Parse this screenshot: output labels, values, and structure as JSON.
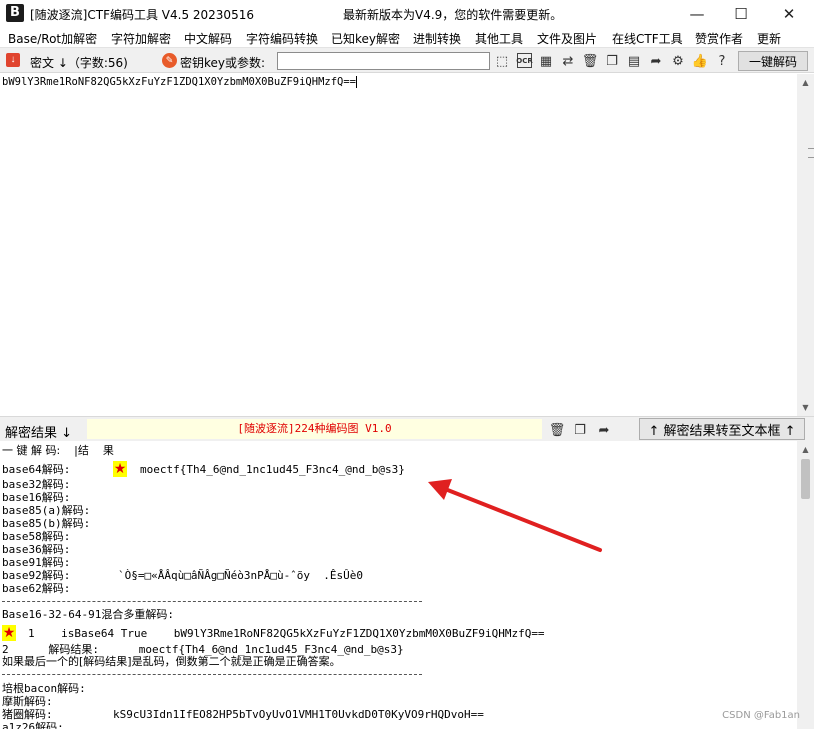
{
  "window": {
    "title": "[随波逐流]CTF编码工具 V4.5 20230516",
    "update_notice": "最新新版本为V4.9，您的软件需要更新。",
    "minimize": "—",
    "maximize": "☐",
    "close": "✕",
    "app_icon": "B"
  },
  "menu": {
    "items": [
      "Base/Rot加解密",
      "字符加解密",
      "中文解码",
      "字符编码转换",
      "已知key解密",
      "进制转换",
      "其他工具",
      "文件及图片",
      "在线CTF工具",
      "赞赏作者",
      "更新"
    ]
  },
  "toolbar": {
    "cipher_label": "密文 ↓（字数:56)",
    "key_label": "密钥key或参数:",
    "key_value": "",
    "ocr_label": "OCR",
    "decode_all_button": "一键解码"
  },
  "input": {
    "ciphertext": "bW9lY3Rme1RoNF82QG5kXzFuYzF1ZDQ1X0YzbmM0X0BuZF9iQHMzfQ=="
  },
  "result_bar": {
    "label": "解密结果 ↓",
    "banner": "[随波逐流]224种编码图 V1.0",
    "transfer_button": "↑ 解密结果转至文本框 ↑"
  },
  "output": {
    "header": "一 键 解 码:    |结    果",
    "lines": [
      {
        "label": "base64解码:",
        "value": "moectf{Th4_6@nd_1nc1ud45_F3nc4_@nd_b@s3}",
        "starred": true
      },
      {
        "label": "base32解码:",
        "value": ""
      },
      {
        "label": "base16解码:",
        "value": ""
      },
      {
        "label": "base85(a)解码:",
        "value": ""
      },
      {
        "label": "base85(b)解码:",
        "value": ""
      },
      {
        "label": "base58解码:",
        "value": ""
      },
      {
        "label": "base36解码:",
        "value": ""
      },
      {
        "label": "base91解码:",
        "value": ""
      },
      {
        "label": "base92解码:",
        "value": "`Ò§=□«ÅÂqù□âÑÂg□Ñéò3nPÅ□ù-ˆõy  .ÊsÛè0"
      },
      {
        "label": "base62解码:",
        "value": ""
      }
    ],
    "separator": "-----------------------------------------------------------",
    "multi_title": "Base16-32-64-91混合多重解码:",
    "multi_row1": "1    isBase64 True    bW9lY3Rme1RoNF82QG5kXzFuYzF1ZDQ1X0YzbmM0X0BuZF9iQHMzfQ==",
    "multi_row2": "2      解码结果:      moectf{Th4_6@nd_1nc1ud45_F3nc4_@nd_b@s3}",
    "multi_note": "如果最后一个的[解码结果]是乱码，倒数第二个就是正确是正确答案。",
    "bacon_title": "培根bacon解码:",
    "morse_title": "摩斯解码:",
    "pigpen_label": "猪圈解码:",
    "pigpen_value": "kS9cU3Idn1IfEO82HP5bTvOyUvO1VMH1T0UvkdD0T0KyVO9rHQDvoH==",
    "a1z26_label": "a1z26解码:"
  },
  "watermark": "CSDN @Fab1an",
  "colors": {
    "toolbar_bg": "#f0f0f0",
    "banner_bg": "#ffffe1",
    "banner_text": "#e00000",
    "star_bg": "#ffff00",
    "star_color": "#e00000",
    "arrow": "#e02020"
  }
}
